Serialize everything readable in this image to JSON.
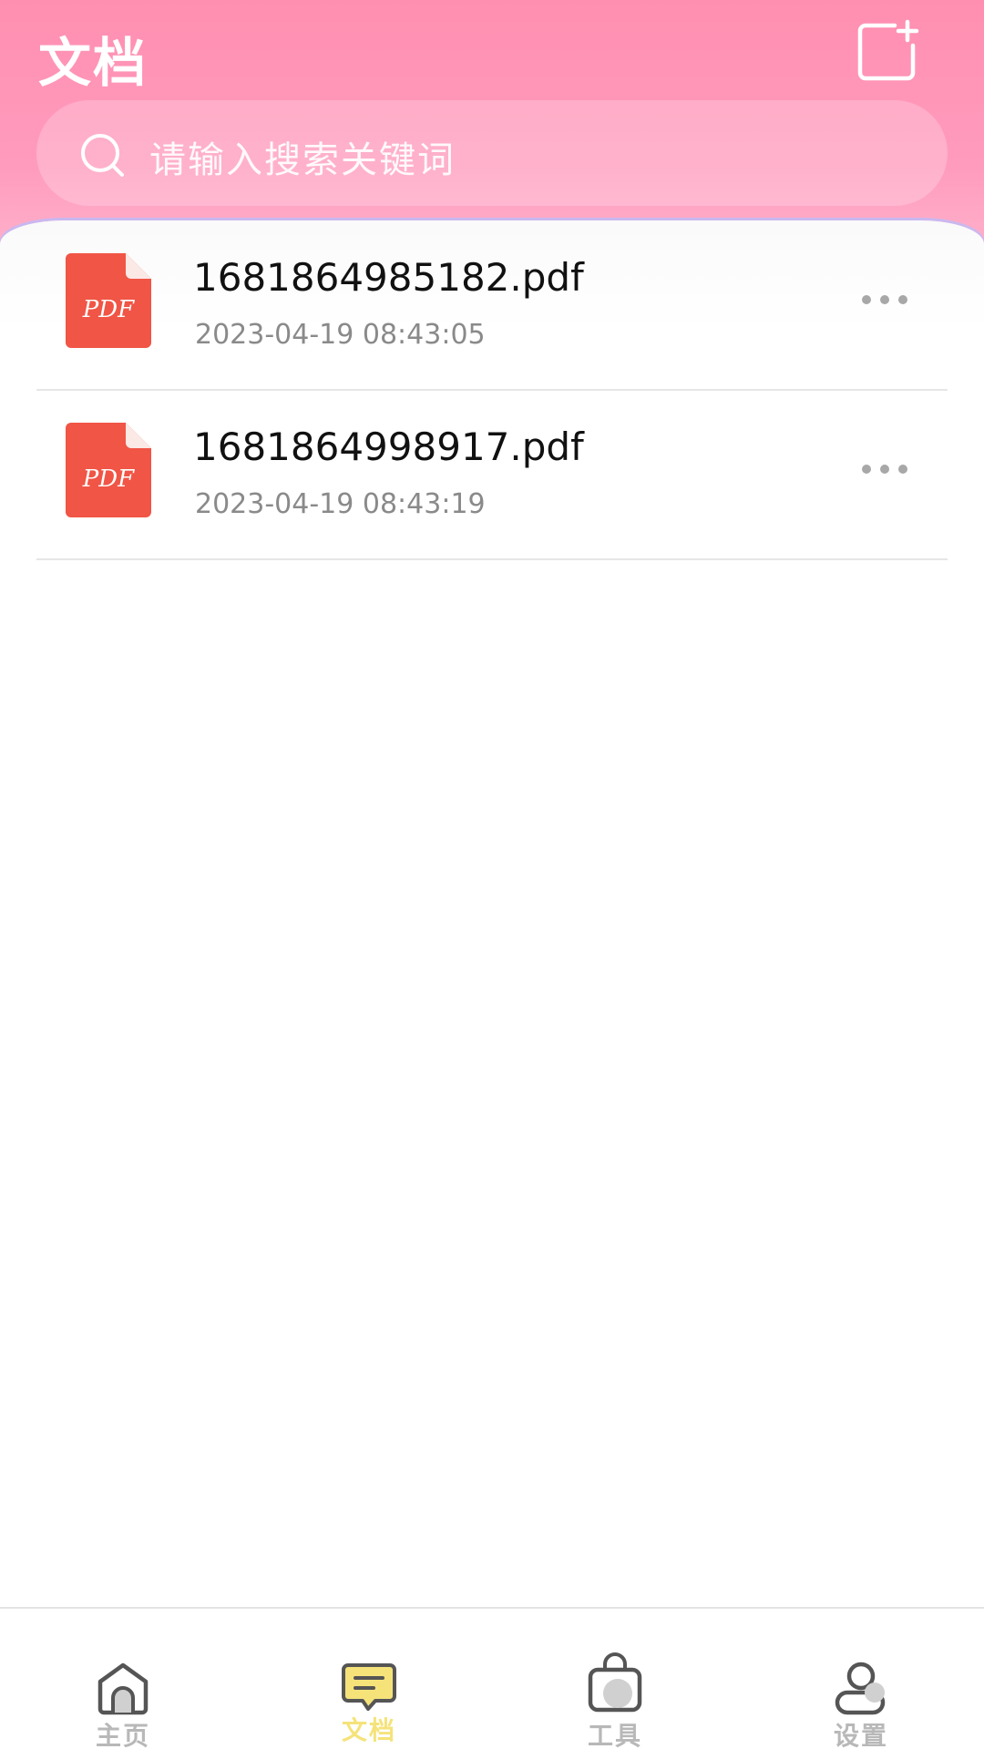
{
  "header": {
    "title": "文档",
    "search_placeholder": "请输入搜索关键词",
    "new_doc_icon": "new-document-icon"
  },
  "colors": {
    "header_pink": "#ff8fb1",
    "pdf_red": "#f05545",
    "active_tab": "#f5e37a",
    "inactive_tab": "#b8b8b8"
  },
  "files": [
    {
      "name": "1681864985182.pdf",
      "time": "2023-04-19 08:43:05",
      "icon": "pdf-file-icon",
      "badge": "PDF"
    },
    {
      "name": "1681864998917.pdf",
      "time": "2023-04-19 08:43:19",
      "icon": "pdf-file-icon",
      "badge": "PDF"
    }
  ],
  "bottom_nav": {
    "items": [
      {
        "label": "主页",
        "icon": "home-icon",
        "active": false
      },
      {
        "label": "文档",
        "icon": "document-chat-icon",
        "active": true
      },
      {
        "label": "工具",
        "icon": "toolbox-bag-icon",
        "active": false
      },
      {
        "label": "设置",
        "icon": "user-settings-icon",
        "active": false
      }
    ]
  }
}
